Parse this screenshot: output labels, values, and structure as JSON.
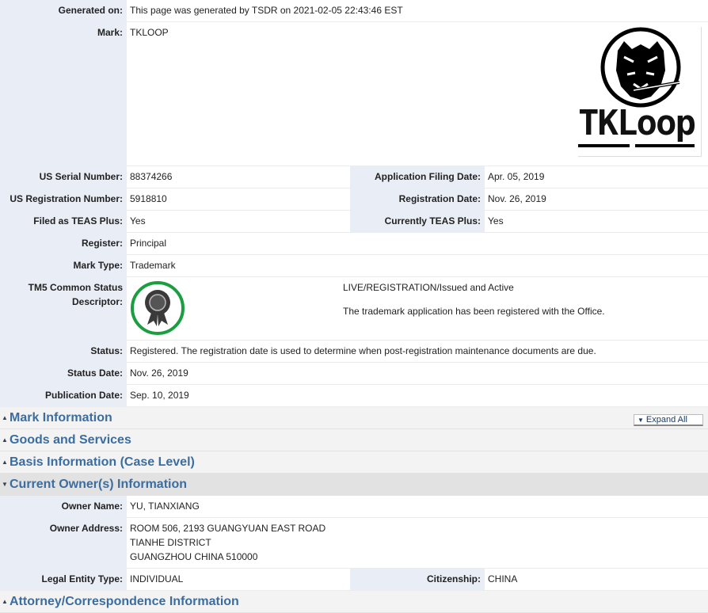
{
  "generated": {
    "label": "Generated on:",
    "value": "This page was generated by TSDR on 2021-02-05 22:43:46 EST"
  },
  "mark": {
    "label": "Mark:",
    "value": "TKLOOP",
    "logo_text": "TKLoop"
  },
  "serial": {
    "label": "US Serial Number:",
    "value": "88374266",
    "label2": "Application Filing Date:",
    "value2": "Apr. 05, 2019"
  },
  "registration": {
    "label": "US Registration Number:",
    "value": "5918810",
    "label2": "Registration Date:",
    "value2": "Nov. 26, 2019"
  },
  "teas": {
    "label": "Filed as TEAS Plus:",
    "value": "Yes",
    "label2": "Currently TEAS Plus:",
    "value2": "Yes"
  },
  "register": {
    "label": "Register:",
    "value": "Principal"
  },
  "mark_type": {
    "label": "Mark Type:",
    "value": "Trademark"
  },
  "tm5": {
    "label_line1": "TM5 Common Status",
    "label_line2": "Descriptor:",
    "status_line": "LIVE/REGISTRATION/Issued and Active",
    "desc_line": "The trademark application has been registered with the Office.",
    "badge_color": "#1a9e3f"
  },
  "status": {
    "label": "Status:",
    "value": "Registered. The registration date is used to determine when post-registration maintenance documents are due."
  },
  "status_date": {
    "label": "Status Date:",
    "value": "Nov. 26, 2019"
  },
  "publication_date": {
    "label": "Publication Date:",
    "value": "Sep. 10, 2019"
  },
  "sections": {
    "mark_info": "Mark Information",
    "goods": "Goods and Services",
    "basis": "Basis Information (Case Level)",
    "owner": "Current Owner(s) Information",
    "attorney": "Attorney/Correspondence Information"
  },
  "expand_all": "Expand All",
  "owner": {
    "name_label": "Owner Name:",
    "name": "YU, TIANXIANG",
    "address_label": "Owner Address:",
    "address_line1": "ROOM 506, 2193 GUANGYUAN EAST ROAD",
    "address_line2": "TIANHE DISTRICT",
    "address_line3": "GUANGZHOU CHINA 510000",
    "entity_label": "Legal Entity Type:",
    "entity": "INDIVIDUAL",
    "citizenship_label": "Citizenship:",
    "citizenship": "CHINA"
  },
  "colors": {
    "label_bg": "#e9edf6",
    "section_title": "#3b6da0"
  }
}
